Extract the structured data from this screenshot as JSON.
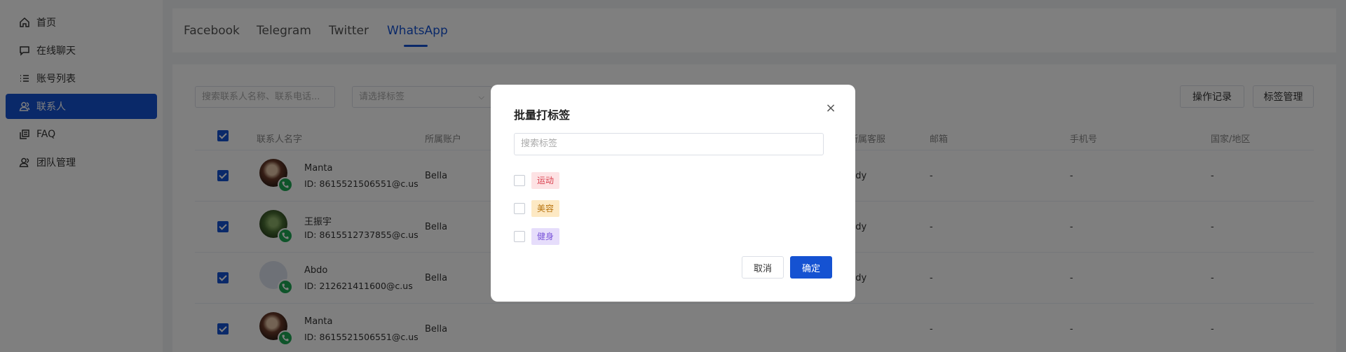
{
  "sidebar": {
    "items": [
      {
        "label": "首页",
        "icon": "home-icon"
      },
      {
        "label": "在线聊天",
        "icon": "chat-icon"
      },
      {
        "label": "账号列表",
        "icon": "list-icon"
      },
      {
        "label": "联系人",
        "icon": "contacts-icon",
        "active": true
      },
      {
        "label": "FAQ",
        "icon": "faq-icon"
      },
      {
        "label": "团队管理",
        "icon": "team-icon"
      }
    ]
  },
  "tabs": [
    {
      "label": "Facebook"
    },
    {
      "label": "Telegram"
    },
    {
      "label": "Twitter"
    },
    {
      "label": "WhatsApp",
      "active": true
    }
  ],
  "toolbar": {
    "search_placeholder": "搜索联系人名称、联系电话...",
    "tag_select_placeholder": "请选择标签",
    "operation_log_label": "操作记录",
    "tag_manage_label": "标签管理"
  },
  "table": {
    "headers": {
      "name": "联系人名字",
      "account": "所属账户",
      "agent": "所属客服",
      "email": "邮箱",
      "phone": "手机号",
      "country": "国家/地区"
    },
    "rows": [
      {
        "name": "Manta",
        "id": "ID: 8615521506551@c.us",
        "account": "Bella",
        "agent": "ndy",
        "email": "-",
        "phone": "-",
        "country": "-"
      },
      {
        "name": "王振宇",
        "id": "ID: 8615512737855@c.us",
        "account": "Bella",
        "agent": "ndy",
        "email": "-",
        "phone": "-",
        "country": "-"
      },
      {
        "name": "Abdo",
        "id": "ID: 212621411600@c.us",
        "account": "Bella",
        "agent": "ndy",
        "email": "-",
        "phone": "-",
        "country": "-"
      },
      {
        "name": "Manta",
        "id": "ID: 8615521506551@c.us",
        "account": "Bella",
        "agent": "",
        "email": "-",
        "phone": "-",
        "country": "-"
      }
    ]
  },
  "dialog": {
    "title": "批量打标签",
    "close_symbol": "×",
    "search_placeholder": "搜索标签",
    "tags": [
      {
        "label": "运动",
        "bg": "#fde2e4",
        "color": "#d9414f"
      },
      {
        "label": "美容",
        "bg": "#fde9c4",
        "color": "#b8730e"
      },
      {
        "label": "健身",
        "bg": "#e6ddfb",
        "color": "#7a55d9"
      }
    ],
    "cancel_label": "取消",
    "confirm_label": "确定"
  },
  "colors": {
    "accent": "#1552d2",
    "whatsapp_green": "#1fa855"
  }
}
